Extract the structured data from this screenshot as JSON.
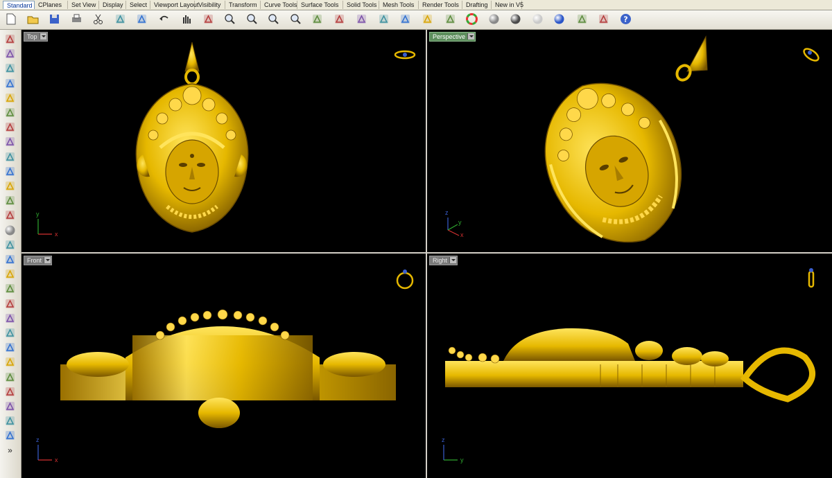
{
  "tabs": [
    "Standard",
    "CPlanes",
    "Set View",
    "Display",
    "Select",
    "Viewport Layout",
    "Visibility",
    "Transform",
    "Curve Tools",
    "Surface Tools",
    "Solid Tools",
    "Mesh Tools",
    "Render Tools",
    "Drafting",
    "New in V5"
  ],
  "active_tab": "Standard",
  "viewports": {
    "top": {
      "label": "Top",
      "axis_h": "x",
      "axis_v": "y"
    },
    "perspective": {
      "label": "Perspective",
      "axis_h": "x",
      "axis_v": "z",
      "axis_d": "y"
    },
    "front": {
      "label": "Front",
      "axis_h": "x",
      "axis_v": "z"
    },
    "right": {
      "label": "Right",
      "axis_h": "y",
      "axis_v": "z"
    }
  },
  "active_viewport": "Perspective",
  "colors": {
    "gold": "#e6b800",
    "gold_dark": "#8a6500",
    "gold_light": "#ffe45c",
    "viewport_bg": "#000000",
    "axis_x": "#d23030",
    "axis_y": "#2fa82f",
    "axis_z": "#3a5fd0",
    "active_label": "#5d8e5d"
  },
  "toolbar_icons": [
    "new-icon",
    "open-icon",
    "save-icon",
    "print-icon",
    "cut-icon",
    "copy-icon",
    "paste-icon",
    "undo-icon",
    "pan-icon",
    "rotate-view-icon",
    "zoom-icon",
    "zoom-window-icon",
    "zoom-extents-icon",
    "zoom-selected-icon",
    "redo-view-icon",
    "properties-icon",
    "grid-snap-icon",
    "osnap-icon",
    "layer-icon",
    "light-icon",
    "material-icon",
    "color-wheel-icon",
    "shaded-sphere-icon",
    "render-sphere-icon",
    "ghost-sphere-icon",
    "blue-sphere-icon",
    "edit-points-icon",
    "dimension-icon",
    "help-icon"
  ],
  "sidebar_icons": [
    "select-arrow-icon",
    "point-icon",
    "polyline-icon",
    "curve-icon",
    "circle-icon",
    "ellipse-icon",
    "polygon-icon",
    "rectangle-icon",
    "arc-icon",
    "helix-icon",
    "surface-icon",
    "extrude-icon",
    "box-icon",
    "sphere-icon",
    "cylinder-icon",
    "mesh-icon",
    "boolean-icon",
    "fillet-icon",
    "join-icon",
    "split-icon",
    "cap-icon",
    "rebuild-icon",
    "text-icon",
    "array-icon",
    "scale-icon",
    "group-icon",
    "dimension-tool-icon",
    "solid-box-icon",
    "more-icon"
  ],
  "more_glyph": "»"
}
